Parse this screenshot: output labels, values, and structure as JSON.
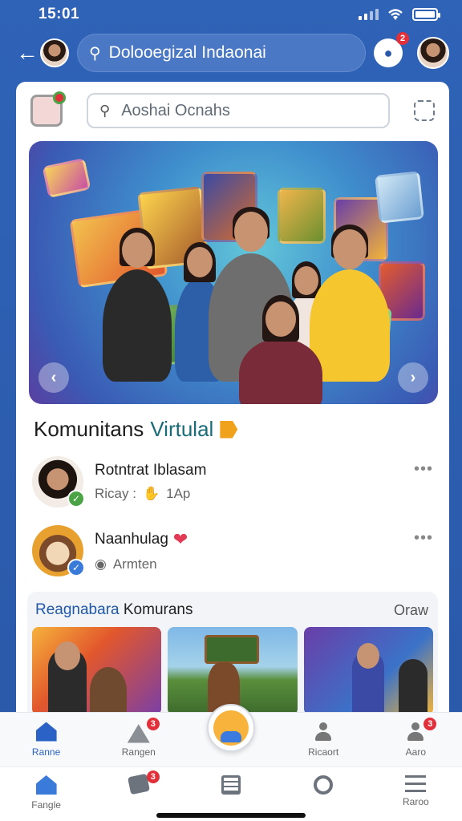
{
  "status_bar": {
    "time": "15:01"
  },
  "top_nav": {
    "search_text": "Dolooegizal Indaonai",
    "notification_count": "2"
  },
  "card": {
    "search_placeholder": "Aoshai Ocnahs",
    "community_title": {
      "part1": "Komunitans",
      "part2": "Virtulal"
    },
    "posts": [
      {
        "name": "Rotntrat Iblasam",
        "sub": "Ricay :",
        "meta": "1Ap",
        "verify_color": "#4ca345"
      },
      {
        "name": "Naanhulag",
        "sub": "Armten",
        "meta": "",
        "verify_color": "#3a7ad8"
      }
    ],
    "recommended": {
      "title_part1": "Reagnabara",
      "title_part2": "Komurans",
      "more": "Oraw"
    }
  },
  "bottom_nav": [
    {
      "label": "Ranne",
      "icon": "home-icon",
      "badge": ""
    },
    {
      "label": "Rangen",
      "icon": "image-icon",
      "badge": "3"
    },
    {
      "label": "",
      "icon": "avatar-fab",
      "badge": ""
    },
    {
      "label": "Ricaort",
      "icon": "profile-icon",
      "badge": ""
    },
    {
      "label": "Aaro",
      "icon": "user-icon",
      "badge": "3"
    }
  ],
  "bottom_nav2": [
    {
      "label": "Fangle",
      "icon": "home-icon",
      "badge": ""
    },
    {
      "label": "",
      "icon": "tag-icon",
      "badge": "3"
    },
    {
      "label": "",
      "icon": "list-icon",
      "badge": ""
    },
    {
      "label": "",
      "icon": "search-icon",
      "badge": ""
    },
    {
      "label": "Raroo",
      "icon": "menu-icon",
      "badge": ""
    }
  ],
  "colors": {
    "brand": "#2f63b7",
    "accent": "#2a63c5",
    "badge": "#e2303a"
  }
}
